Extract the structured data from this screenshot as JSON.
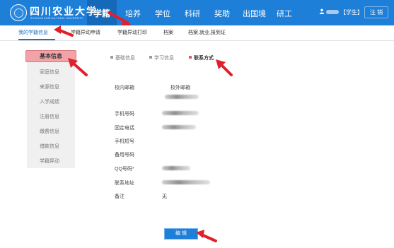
{
  "header": {
    "university_name": "四川农业大学",
    "university_subtitle": "SICHUAN AGRICULTURAL UNIVERSITY",
    "nav": [
      "学籍",
      "培养",
      "学位",
      "科研",
      "奖助",
      "出国境",
      "研工"
    ],
    "active_nav": "学籍",
    "user_role": "【学生】",
    "logout_label": "注 销"
  },
  "subnav": {
    "items": [
      "我的学籍信息",
      "学籍异动申请",
      "学籍异动打印",
      "档案",
      "档案,就业,报到证"
    ],
    "active": "我的学籍信息"
  },
  "sidebar": {
    "active": "基本信息",
    "items": [
      "家庭信息",
      "来源信息",
      "入学成绩",
      "注册信息",
      "缴费信息",
      "借款信息",
      "学籍异动"
    ]
  },
  "tabs": {
    "items": [
      "基础信息",
      "学习信息",
      "联系方式"
    ],
    "active": "联系方式"
  },
  "form": {
    "campus_email_label": "校内邮箱",
    "external_email_label": "校外邮箱",
    "phone_label": "手机号码",
    "landline_label": "固定电话",
    "short_phone_label": "手机短号",
    "backup_phone_label": "备用号码",
    "qq_label": "QQ号码",
    "qq_required_mark": "*",
    "address_label": "联系地址",
    "remark_label": "备注",
    "remark_value": "无"
  },
  "actions": {
    "edit_label": "编  辑"
  },
  "colors": {
    "header_blue": "#1e7fd8",
    "active_pink": "#f2a3a8",
    "annotation_red": "#e0202a"
  }
}
